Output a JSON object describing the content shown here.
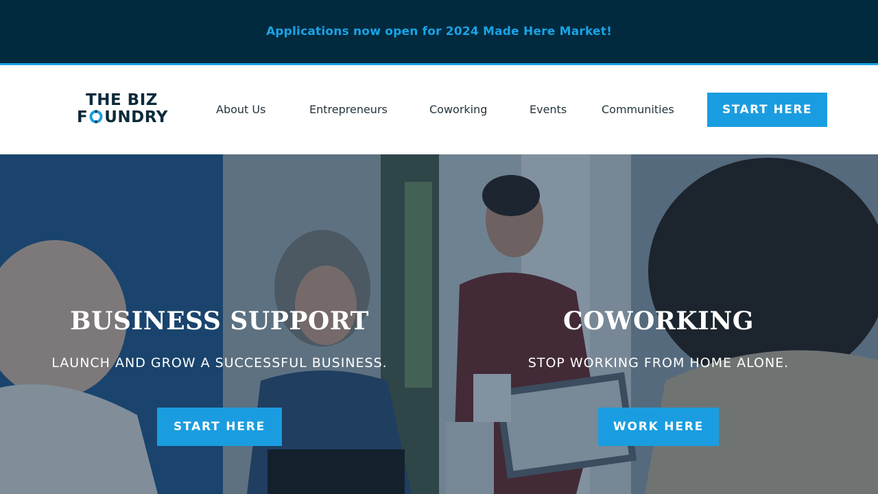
{
  "announcement": {
    "text": "Applications now open for 2024 Made Here Market!"
  },
  "logo": {
    "line1": "THE BIZ",
    "line2_prefix": "F",
    "line2_suffix": "UNDRY"
  },
  "nav": {
    "items": [
      {
        "label": "About Us"
      },
      {
        "label": "Entrepreneurs"
      },
      {
        "label": "Coworking"
      },
      {
        "label": "Events"
      },
      {
        "label": "Communities"
      }
    ],
    "cta_label": "START HERE"
  },
  "hero": {
    "left": {
      "title": "BUSINESS SUPPORT",
      "subtitle": "LAUNCH AND GROW A SUCCESSFUL BUSINESS.",
      "button_label": "START HERE"
    },
    "right": {
      "title": "COWORKING",
      "subtitle": "STOP WORKING FROM HOME ALONE.",
      "button_label": "WORK HERE"
    }
  },
  "colors": {
    "announcement_bg": "#012a3e",
    "accent": "#1a9de0",
    "logo_text": "#0b2a3a",
    "nav_text": "#24343e"
  }
}
